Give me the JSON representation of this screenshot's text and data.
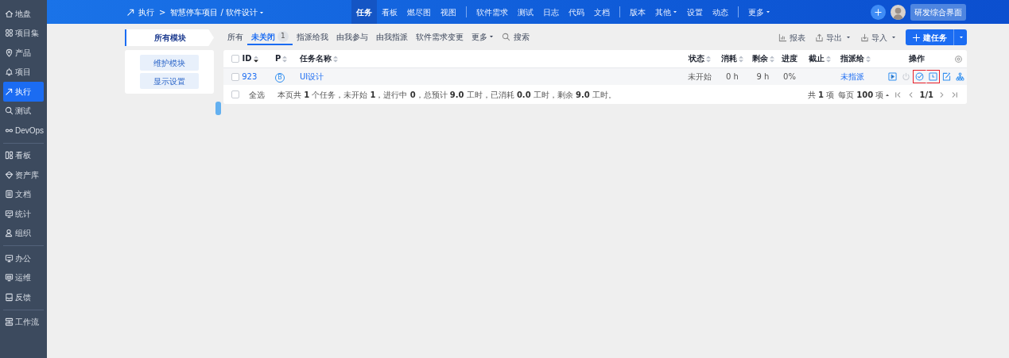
{
  "sidebar": {
    "groups": [
      [
        {
          "label": "地盘",
          "selected": false
        },
        {
          "label": "项目集",
          "selected": false
        },
        {
          "label": "产品",
          "selected": false
        },
        {
          "label": "项目",
          "selected": false
        },
        {
          "label": "执行",
          "selected": true
        },
        {
          "label": "测试",
          "selected": false
        },
        {
          "label": "DevOps",
          "selected": false
        }
      ],
      [
        {
          "label": "看板",
          "selected": false
        },
        {
          "label": "资产库",
          "selected": false
        },
        {
          "label": "文档",
          "selected": false
        },
        {
          "label": "统计",
          "selected": false
        },
        {
          "label": "组织",
          "selected": false
        }
      ],
      [
        {
          "label": "办公",
          "selected": false
        },
        {
          "label": "运维",
          "selected": false
        },
        {
          "label": "反馈",
          "selected": false
        }
      ],
      [
        {
          "label": "工作流",
          "selected": false
        }
      ]
    ]
  },
  "topbar": {
    "breadcrumb": {
      "root": "执行",
      "separator": ">",
      "current": "智慧停车项目 / 软件设计",
      "dropdown": true
    },
    "nav_groups": [
      [
        {
          "label": "任务",
          "selected": true,
          "dropdown": false
        },
        {
          "label": "看板",
          "selected": false,
          "dropdown": false
        },
        {
          "label": "燃尽图",
          "selected": false,
          "dropdown": false
        },
        {
          "label": "视图",
          "selected": false,
          "dropdown": false
        }
      ],
      [
        {
          "label": "软件需求",
          "selected": false,
          "dropdown": false
        },
        {
          "label": "测试",
          "selected": false,
          "dropdown": false
        },
        {
          "label": "日志",
          "selected": false,
          "dropdown": false
        },
        {
          "label": "代码",
          "selected": false,
          "dropdown": false
        },
        {
          "label": "文档",
          "selected": false,
          "dropdown": false
        }
      ],
      [
        {
          "label": "版本",
          "selected": false,
          "dropdown": false
        },
        {
          "label": "其他",
          "selected": false,
          "dropdown": true
        },
        {
          "label": "设置",
          "selected": false,
          "dropdown": false
        },
        {
          "label": "动态",
          "selected": false,
          "dropdown": false
        }
      ],
      [
        {
          "label": "更多",
          "selected": false,
          "dropdown": true
        }
      ]
    ],
    "workspace_button": "研发综合界面"
  },
  "module_panel": {
    "title": "所有模块",
    "buttons": [
      "维护模块",
      "显示设置"
    ]
  },
  "filters": [
    {
      "label": "所有",
      "selected": false
    },
    {
      "label": "未关闭",
      "selected": true,
      "count": "1"
    },
    {
      "label": "指派给我",
      "selected": false
    },
    {
      "label": "由我参与",
      "selected": false
    },
    {
      "label": "由我指派",
      "selected": false
    },
    {
      "label": "软件需求变更",
      "selected": false
    },
    {
      "label": "更多",
      "selected": false,
      "dropdown": true
    }
  ],
  "search_label": "搜索",
  "toolbar": [
    {
      "label": "报表",
      "kind": "link",
      "dropdown": false
    },
    {
      "label": "导出",
      "kind": "link",
      "dropdown": true
    },
    {
      "label": "导入",
      "kind": "link",
      "dropdown": true
    },
    {
      "label": "建任务",
      "kind": "primary",
      "dropdown": true
    }
  ],
  "table": {
    "header_checked": false,
    "columns": [
      {
        "label": "ID",
        "sortable": true,
        "sorted_desc": true
      },
      {
        "label": "P",
        "sortable": true,
        "sorted_desc": false
      },
      {
        "label": "任务名称",
        "sortable": true,
        "sorted_desc": false
      },
      {
        "label": "状态",
        "sortable": true,
        "sorted_desc": false
      },
      {
        "label": "消耗",
        "sortable": true,
        "sorted_desc": false
      },
      {
        "label": "剩余",
        "sortable": true,
        "sorted_desc": false
      },
      {
        "label": "进度",
        "sortable": false
      },
      {
        "label": "截止",
        "sortable": true,
        "sorted_desc": false
      },
      {
        "label": "指派给",
        "sortable": true,
        "sorted_desc": false
      },
      {
        "label": "操作",
        "sortable": false
      }
    ],
    "rows": [
      {
        "checked": false,
        "id": "923",
        "priority": "B",
        "name": "UI设计",
        "status": "未开始",
        "consumed": "0 h",
        "left": "9 h",
        "progress": "0%",
        "assigned_to": "未指派",
        "actions": [
          {
            "disabled": false,
            "highlighted": false
          },
          {
            "disabled": true,
            "highlighted": false
          },
          {
            "disabled": false,
            "highlighted": true
          },
          {
            "disabled": false,
            "highlighted": true
          },
          {
            "disabled": false,
            "highlighted": false
          },
          {
            "disabled": false,
            "highlighted": false
          }
        ]
      }
    ],
    "footer": {
      "select_all": "全选",
      "select_all_checked": false,
      "summary": "本页共 **1** 个任务，未开始 **1**，进行中 **0**，总预计 **9.0** 工时，已消耗 **0.0** 工时，剩余 **9.0** 工时。",
      "total": "共 **1** 项",
      "page_size": "每页 **100** 项",
      "page": "1/1"
    }
  }
}
